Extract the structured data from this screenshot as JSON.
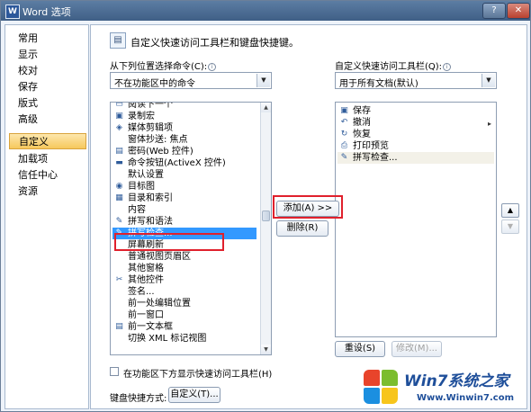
{
  "window": {
    "title": "Word 选项",
    "help_label": "?",
    "close_label": "✕",
    "app_icon": "W"
  },
  "nav": {
    "items": [
      {
        "label": "常用"
      },
      {
        "label": "显示"
      },
      {
        "label": "校对"
      },
      {
        "label": "保存"
      },
      {
        "label": "版式"
      },
      {
        "label": "高级"
      },
      {
        "label": "自定义"
      },
      {
        "label": "加载项"
      },
      {
        "label": "信任中心"
      },
      {
        "label": "资源"
      }
    ],
    "selected": "自定义"
  },
  "header": {
    "text": "自定义快速访问工具栏和键盘快捷键。"
  },
  "left": {
    "choose_label": "从下列位置选择命令(C):",
    "choose_value": "不在功能区中的命令",
    "items": [
      {
        "label": "阅读下一个",
        "icon": "▭"
      },
      {
        "label": "录制宏",
        "icon": "▣"
      },
      {
        "label": "媒体剪辑项",
        "icon": "◈"
      },
      {
        "label": "窗体抄送: 焦点",
        "icon": ""
      },
      {
        "label": "密码(Web 控件)",
        "icon": "▤"
      },
      {
        "label": "命令按钮(ActiveX 控件)",
        "icon": "▬"
      },
      {
        "label": "默认设置",
        "icon": ""
      },
      {
        "label": "目标图",
        "icon": "◉"
      },
      {
        "label": "目录和索引",
        "icon": "▦"
      },
      {
        "label": "内容",
        "icon": ""
      },
      {
        "label": "拼写和语法",
        "icon": "✎"
      },
      {
        "label": "拼写检查...",
        "icon": "✎"
      },
      {
        "label": "屏幕刷新",
        "icon": ""
      },
      {
        "label": "普通视图页眉区",
        "icon": ""
      },
      {
        "label": "其他窗格",
        "icon": ""
      },
      {
        "label": "其他控件",
        "icon": "✂"
      },
      {
        "label": "签名...",
        "icon": ""
      },
      {
        "label": "前一处编辑位置",
        "icon": ""
      },
      {
        "label": "前一窗口",
        "icon": ""
      },
      {
        "label": "前一文本框",
        "icon": "▤"
      },
      {
        "label": "切换 XML 标记视图",
        "icon": ""
      }
    ],
    "selected_index": 11,
    "checkbox_label": "在功能区下方显示快速访问工具栏(H)",
    "keyboard_label": "键盘快捷方式:",
    "customize_label": "自定义(T)..."
  },
  "middle": {
    "add_label": "添加(A) >>",
    "remove_label": "删除(R)"
  },
  "right": {
    "customize_label": "自定义快速访问工具栏(Q):",
    "customize_value": "用于所有文档(默认)",
    "items": [
      {
        "label": "保存",
        "icon": "▣"
      },
      {
        "label": "撤消",
        "icon": "↶"
      },
      {
        "label": "恢复",
        "icon": "↻"
      },
      {
        "label": "打印预览",
        "icon": "⎙"
      },
      {
        "label": "拼写检查...",
        "icon": "✎"
      }
    ],
    "reset_label": "重设(S)",
    "modify_label": "修改(M)...",
    "move_up": "▲",
    "move_down": "▼",
    "expand_arrow": "▸"
  },
  "watermark": {
    "title": "Win7系统之家",
    "url": "Www.Winwin7.com"
  }
}
